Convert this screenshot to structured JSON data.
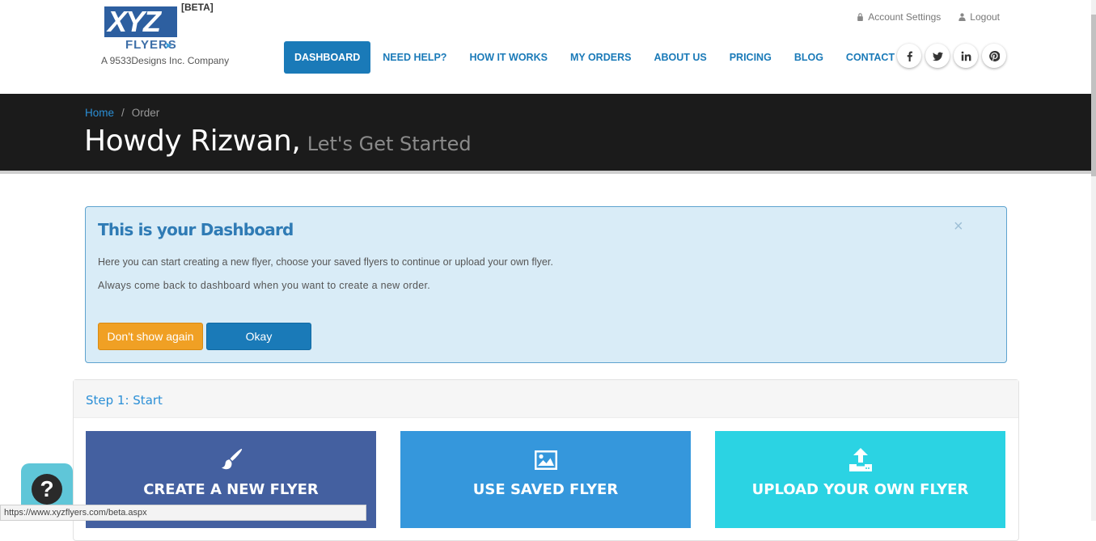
{
  "logo": {
    "brand": "XYZ",
    "sub": "FLYERS",
    "beta": "[BETA]",
    "company": "A 9533Designs Inc. Company"
  },
  "top_links": {
    "account": "Account Settings",
    "logout": "Logout"
  },
  "nav": {
    "items": [
      "DASHBOARD",
      "NEED HELP?",
      "HOW IT WORKS",
      "MY ORDERS",
      "ABOUT US",
      "PRICING",
      "BLOG",
      "CONTACT"
    ],
    "active": "DASHBOARD"
  },
  "socials": [
    "facebook-icon",
    "twitter-icon",
    "linkedin-icon",
    "pinterest-icon"
  ],
  "breadcrumb": {
    "home": "Home",
    "separator": "/",
    "current": "Order"
  },
  "greeting": {
    "main": "Howdy Rizwan,",
    "sub": "Let's Get Started"
  },
  "alert": {
    "title": "This is your Dashboard",
    "close": "×",
    "line1": "Here you can start creating a new flyer, choose your saved flyers to continue or upload your own flyer.",
    "line2": "Always come back to dashboard when you want to create a new order.",
    "dont_show": "Don't show again",
    "okay": "Okay"
  },
  "step": {
    "title": "Step 1: Start",
    "cards": [
      {
        "label": "CREATE A NEW FLYER",
        "icon": "brush-icon",
        "color": "#4460a0"
      },
      {
        "label": "USE SAVED FLYER",
        "icon": "image-icon",
        "color": "#3597dc"
      },
      {
        "label": "UPLOAD YOUR OWN FLYER",
        "icon": "upload-icon",
        "color": "#2bd3e3"
      }
    ]
  },
  "help": {
    "symbol": "?"
  },
  "status_bar": {
    "url": "https://www.xyzflyers.com/beta.aspx"
  },
  "colors": {
    "primary": "#1a7ab8",
    "banner": "#1b1b1b",
    "alert_bg": "#d9ecf7",
    "warning": "#f0a024"
  }
}
